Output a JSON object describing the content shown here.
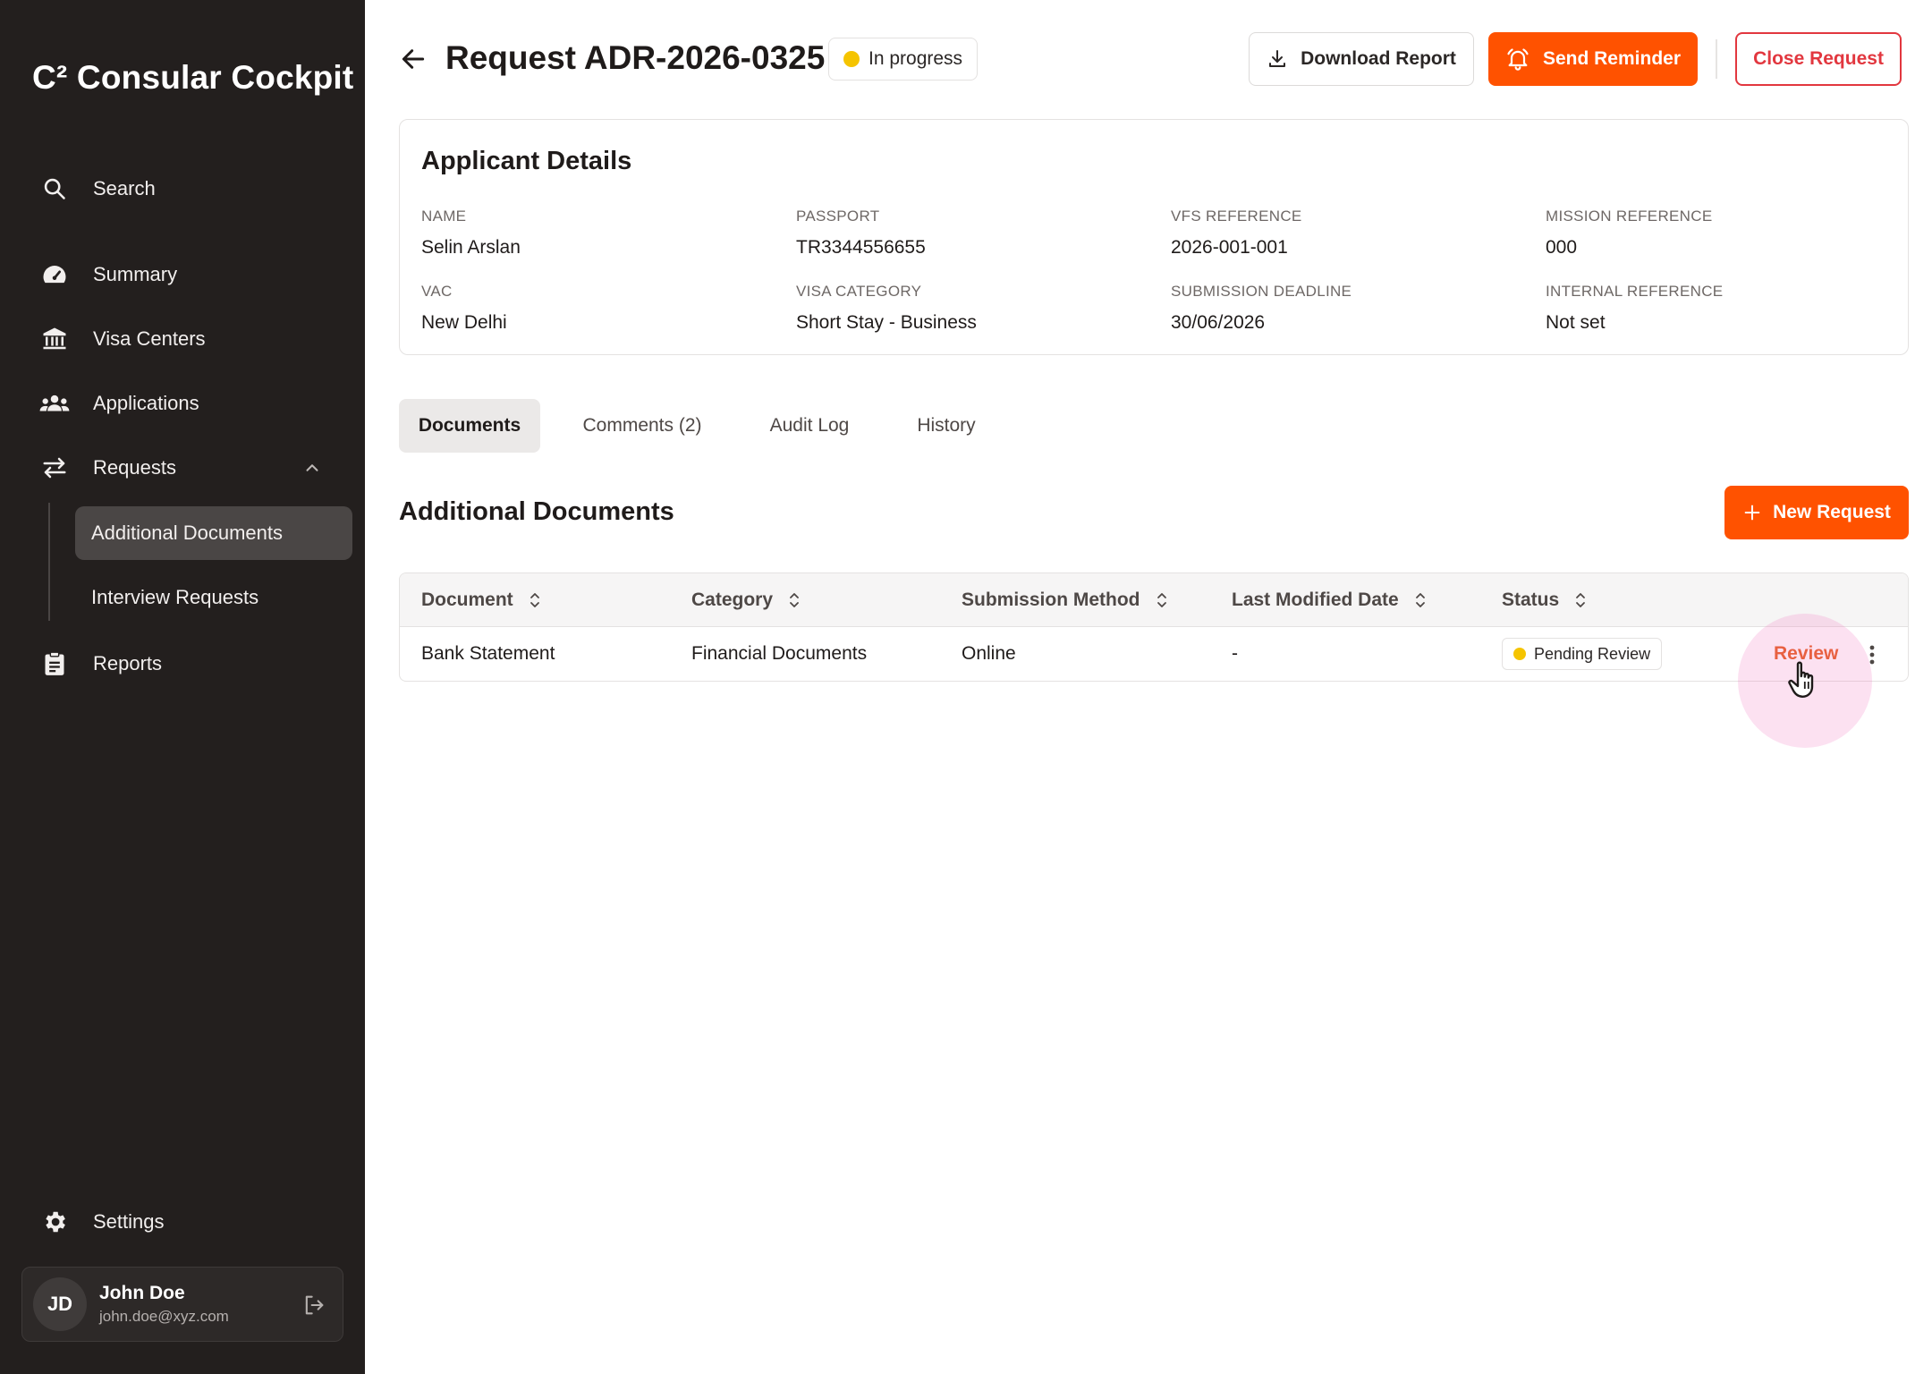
{
  "sidebar": {
    "brand": "C² Consular Cockpit",
    "search_label": "Search",
    "items": [
      {
        "label": "Summary",
        "icon": "gauge-icon"
      },
      {
        "label": "Visa Centers",
        "icon": "bank-icon"
      },
      {
        "label": "Applications",
        "icon": "users-icon"
      },
      {
        "label": "Requests",
        "icon": "swap-arrows-icon"
      },
      {
        "label": "Reports",
        "icon": "clipboard-icon"
      }
    ],
    "sub_items": [
      {
        "label": "Additional Documents",
        "active": true
      },
      {
        "label": "Interview Requests",
        "active": false
      }
    ],
    "settings_label": "Settings",
    "user": {
      "initials": "JD",
      "name": "John Doe",
      "email": "john.doe@xyz.com"
    }
  },
  "header": {
    "title": "Request ADR-2026-0325",
    "status": "In progress",
    "download_label": "Download Report",
    "reminder_label": "Send Reminder",
    "close_label": "Close Request"
  },
  "applicant": {
    "title": "Applicant Details",
    "fields": [
      {
        "key": "NAME",
        "value": "Selin Arslan"
      },
      {
        "key": "PASSPORT",
        "value": "TR3344556655"
      },
      {
        "key": "VFS REFERENCE",
        "value": "2026-001-001"
      },
      {
        "key": "MISSION REFERENCE",
        "value": "000"
      },
      {
        "key": "VAC",
        "value": "New Delhi"
      },
      {
        "key": "VISA CATEGORY",
        "value": "Short Stay - Business"
      },
      {
        "key": "SUBMISSION DEADLINE",
        "value": "30/06/2026"
      },
      {
        "key": "INTERNAL REFERENCE",
        "value": "Not set"
      }
    ]
  },
  "tabs": [
    {
      "label": "Documents",
      "active": true
    },
    {
      "label": "Comments (2)",
      "active": false
    },
    {
      "label": "Audit Log",
      "active": false
    },
    {
      "label": "History",
      "active": false
    }
  ],
  "section": {
    "title": "Additional Documents",
    "new_request_label": "New Request"
  },
  "table": {
    "columns": [
      "Document",
      "Category",
      "Submission Method",
      "Last Modified Date",
      "Status"
    ],
    "rows": [
      {
        "document": "Bank Statement",
        "category": "Financial Documents",
        "method": "Online",
        "modified": "-",
        "status": "Pending Review",
        "action": "Review"
      }
    ]
  },
  "colors": {
    "sidebar_bg": "#231f1e",
    "accent": "#ff5200",
    "danger": "#e2373f",
    "status_dot": "#f5c400"
  }
}
